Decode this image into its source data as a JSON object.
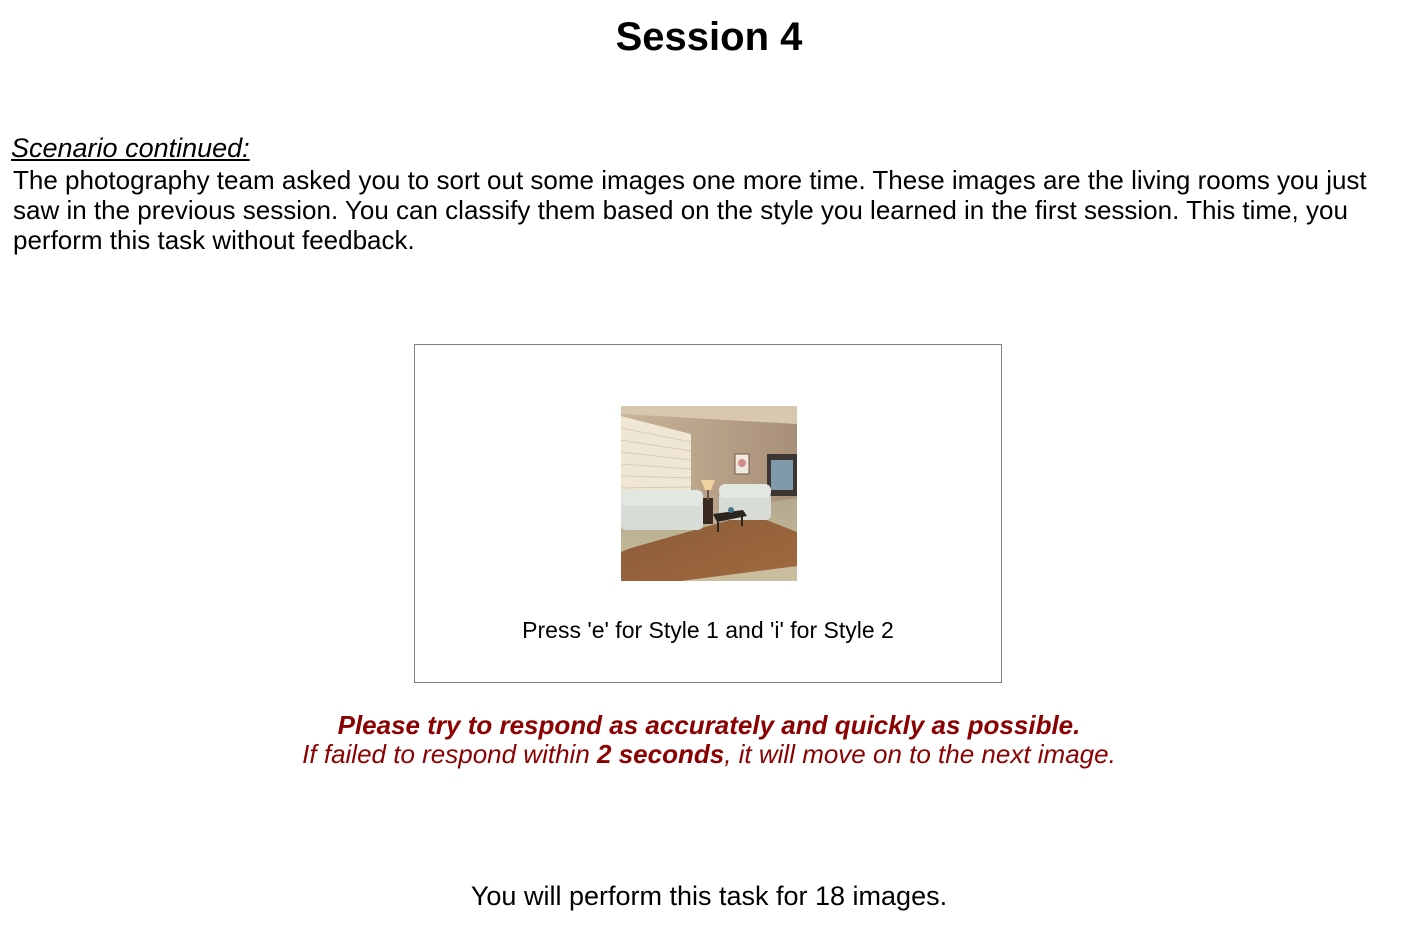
{
  "page": {
    "title": "Session 4"
  },
  "scenario": {
    "heading": "Scenario continued:",
    "text": "The photography team asked you to sort out some images one more time. These images are the living rooms you just saw in the previous session. You can classify them based on the style you learned in the first session. This time, you perform this task without feedback."
  },
  "stimulus": {
    "image_subject": "living-room-photo",
    "prompt": "Press 'e' for Style 1 and 'i' for Style 2"
  },
  "warning": {
    "line1": "Please try to respond as accurately and quickly as possible.",
    "line2_before": "If failed to respond within ",
    "line2_emphasis": "2 seconds",
    "line2_after": ", it will move on to the next image.",
    "color": "#8b0000"
  },
  "footer": {
    "text": "You will perform this task for 18 images."
  }
}
